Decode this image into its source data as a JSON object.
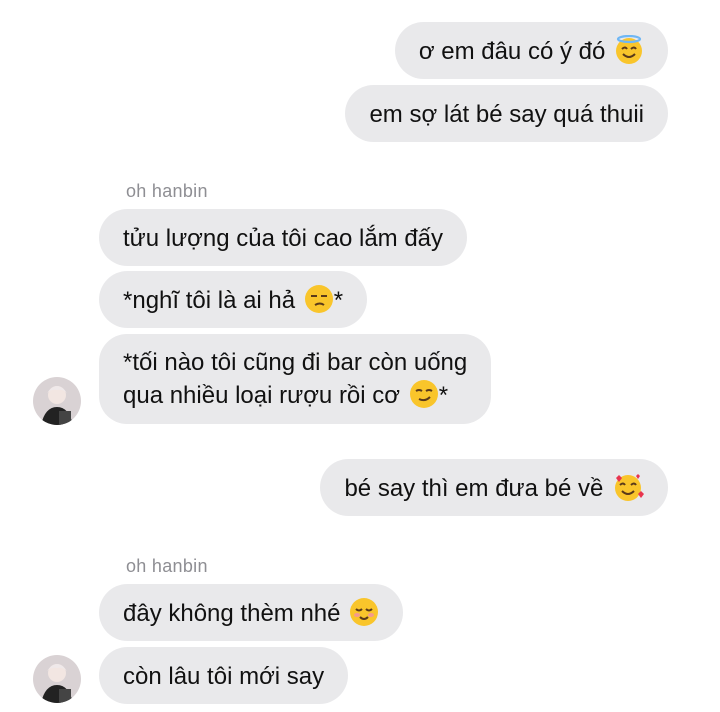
{
  "messages": [
    {
      "sender": "me",
      "text": "ơ em đâu có ý đó",
      "emoji": "smiling-halo-emoji"
    },
    {
      "sender": "me",
      "text": "em sợ lát bé say quá thuii"
    },
    {
      "sender_label": "oh hanbin"
    },
    {
      "sender": "oh hanbin",
      "text": "tửu lượng của tôi cao lắm đấy"
    },
    {
      "sender": "oh hanbin",
      "text_before": "*nghĩ tôi là ai hả ",
      "emoji": "unamused-face-emoji",
      "text_after": "*"
    },
    {
      "sender": "oh hanbin",
      "line1": "*tối nào tôi cũng đi bar còn uống",
      "line2_before": "qua nhiều loại rượu rồi cơ ",
      "emoji": "smirking-face-emoji",
      "line2_after": "*"
    },
    {
      "sender": "me",
      "text": "bé say thì em đưa bé về ",
      "emoji": "smiling-face-with-hearts-emoji"
    },
    {
      "sender_label": "oh hanbin"
    },
    {
      "sender": "oh hanbin",
      "text": "đây không thèm nhé ",
      "emoji": "smiling-relaxed-emoji"
    },
    {
      "sender": "oh hanbin",
      "text": "còn lâu tôi mới say"
    }
  ],
  "colors": {
    "bubble_bg": "#e9e9eb",
    "text": "#111111",
    "sender_label": "#8e8e93",
    "emoji_yellow": "#f9c52b"
  }
}
